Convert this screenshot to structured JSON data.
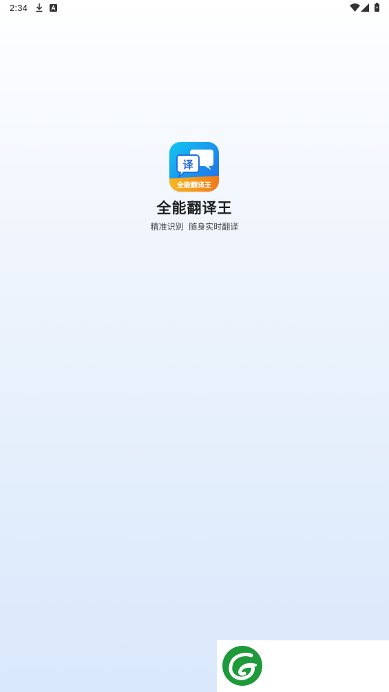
{
  "status_bar": {
    "time": "2:34",
    "left_icons": [
      "download-icon",
      "a-notification-icon"
    ],
    "right_icons": [
      "wifi-icon",
      "cellular-signal-icon",
      "battery-icon"
    ]
  },
  "splash": {
    "app_icon": {
      "glyph": "译",
      "banner_text": "全能翻译王",
      "colors": {
        "gradient_start": "#14c6f0",
        "gradient_end": "#2266e6",
        "banner_start": "#f6b81f",
        "banner_end": "#f27a1a"
      }
    },
    "app_name": "全能翻译王",
    "slogan": "精准识别  随身实时翻译"
  },
  "ad": {
    "logo": "green-leaf-logo-icon",
    "color": "#1e9a3a"
  }
}
